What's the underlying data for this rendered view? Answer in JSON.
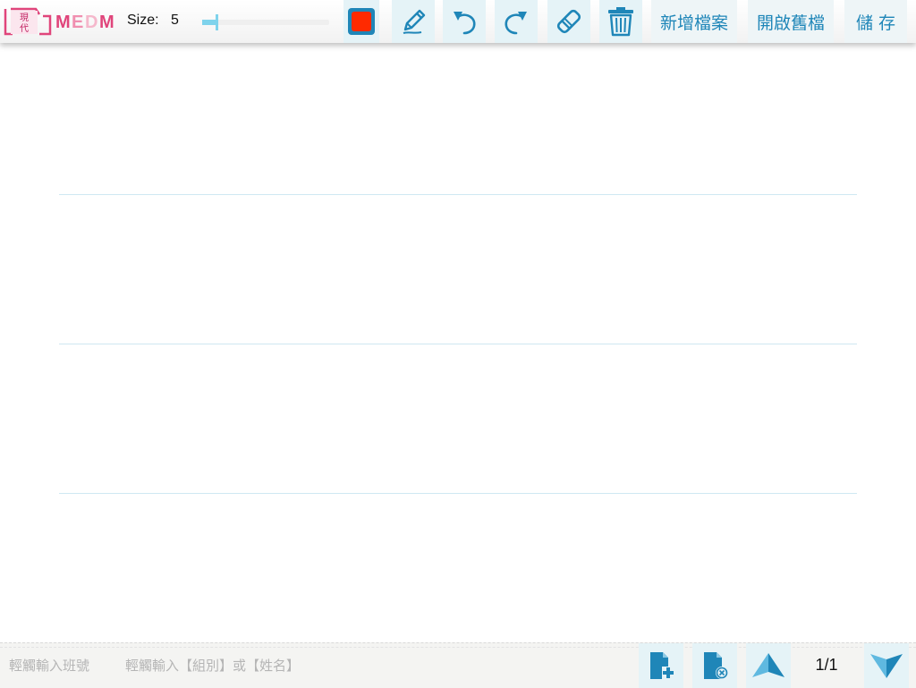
{
  "logo": {
    "badge_text": "現代",
    "brand_text": "MEDM"
  },
  "size": {
    "label": "Size:",
    "value": "5",
    "fraction": 0.05
  },
  "colors": {
    "pen": "#ff2a00",
    "accent": "#1f86b8",
    "rule_line": "#cfe8f2",
    "slider": "#7fd3ec"
  },
  "tools": [
    {
      "name": "color-swatch"
    },
    {
      "name": "pencil-icon"
    },
    {
      "name": "undo-icon"
    },
    {
      "name": "redo-icon"
    },
    {
      "name": "eraser-icon"
    },
    {
      "name": "trash-icon"
    }
  ],
  "buttons": {
    "new_file": "新增檔案",
    "open_file": "開啟舊檔",
    "save": "儲 存"
  },
  "bottom": {
    "class_placeholder": "輕觸輸入班號",
    "group_placeholder": "輕觸輸入【組別】或【姓名】",
    "page_indicator": "1/1"
  }
}
